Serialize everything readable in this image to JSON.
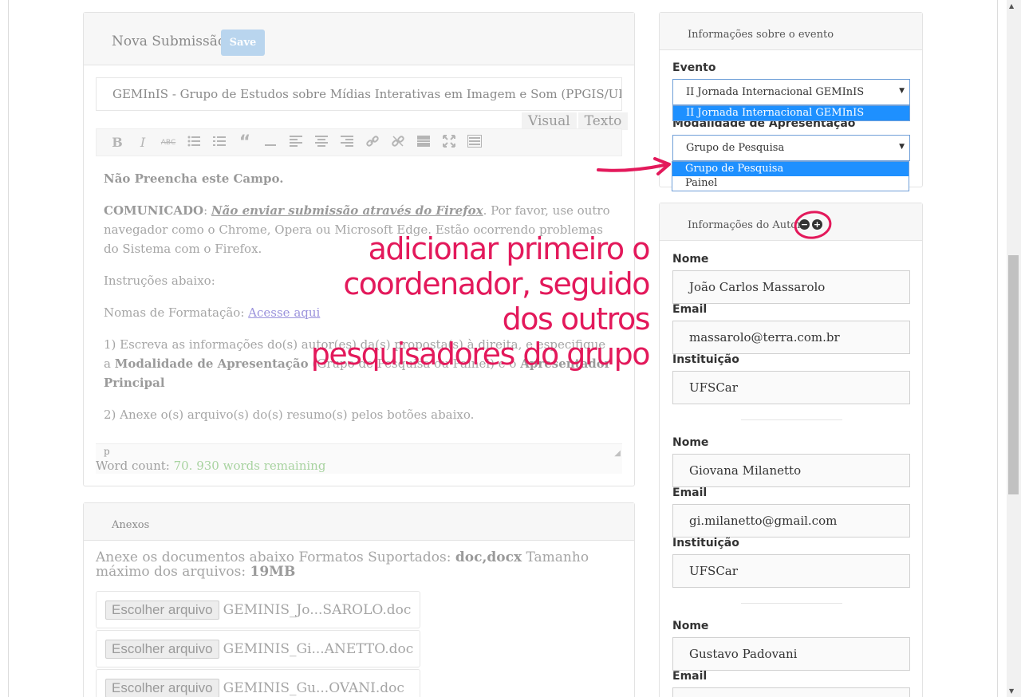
{
  "main": {
    "title": "Nova Submissão",
    "save_label": "Save",
    "title_input_value": "GEMInIS - Grupo de Estudos sobre Mídias Interativas em Imagem e Som (PPGIS/UFSCar)",
    "tab_visual": "Visual",
    "tab_text": "Texto",
    "toolbar_icons": [
      "bold-icon",
      "italic-icon",
      "strikethrough-icon",
      "bullet-list-icon",
      "numbered-list-icon",
      "quote-icon",
      "horizontal-rule-icon",
      "align-left-icon",
      "align-center-icon",
      "align-right-icon",
      "link-icon",
      "unlink-icon",
      "read-more-icon",
      "fullscreen-icon",
      "toolbar-toggle-icon"
    ],
    "content": {
      "line1": "Não Preencha este Campo.",
      "comunicado_label": "COMUNICADO",
      "comunicado_sep": ": ",
      "comunicado_warn": "Não enviar submissão através do Firefox",
      "comunicado_rest": ". Por favor, use outro navegador como o Chrome, Opera ou Microsoft Edge. Estão ocorrendo problemas do Sistema com o Firefox.",
      "instructions": "Instruções abaixo:",
      "norms_label": "Nomas de Formatação: ",
      "norms_link": "Acesse aqui",
      "step1_a": "1) Escreva as informações do(s) autor(es) da(s) proposta(s) à direita, e especifique a ",
      "step1_b": "Modalidade de Apresentação",
      "step1_c": " (Grupo de Pesquisa ou Painel) e o ",
      "step1_d": "Apresentador Principal",
      "step2": "2) Anexe o(s) arquivo(s) do(s) resumo(s) pelos botões abaixo."
    },
    "path_label": "p",
    "word_count_label": "Word count: ",
    "word_count_value": "70. 930 words remaining"
  },
  "attachments": {
    "title": "Anexos",
    "desc_a": "Anexe os documentos abaixo Formatos Suportados: ",
    "desc_formats": "doc,docx",
    "desc_b": " Tamanho máximo dos arquivos: ",
    "desc_size": "19MB",
    "button_label": "Escolher arquivo",
    "files": [
      "GEMINIS_Jo...SAROLO.doc",
      "GEMINIS_Gi...ANETTO.doc",
      "GEMINIS_Gu...OVANI.doc"
    ]
  },
  "event": {
    "title": "Informações sobre o evento",
    "evento_label": "Evento",
    "evento_value": "II Jornada Internacional GEMInIS",
    "evento_options": [
      "II Jornada Internacional GEMInIS"
    ],
    "modalidade_label": "Modalidade de Apresentação",
    "modalidade_value": "Grupo de Pesquisa",
    "modalidade_options": [
      "Grupo de Pesquisa",
      "Painel"
    ]
  },
  "authors": {
    "title": "Informações do Autor",
    "nome_label": "Nome",
    "email_label": "Email",
    "inst_label": "Instituição",
    "list": [
      {
        "nome": "João Carlos Massarolo",
        "email": "massarolo@terra.com.br",
        "inst": "UFSCar"
      },
      {
        "nome": "Giovana Milanetto",
        "email": "gi.milanetto@gmail.com",
        "inst": "UFSCar"
      },
      {
        "nome": "Gustavo Padovani",
        "email": "",
        "inst": ""
      }
    ]
  },
  "annotation": {
    "text": "adicionar primeiro o coordenador, seguido dos outros pesquisadores do grupo",
    "color": "#e3195b"
  },
  "colors": {
    "accent_blue": "#1e90ff",
    "save_button": "#b9d5ee",
    "annotation": "#e3195b"
  }
}
